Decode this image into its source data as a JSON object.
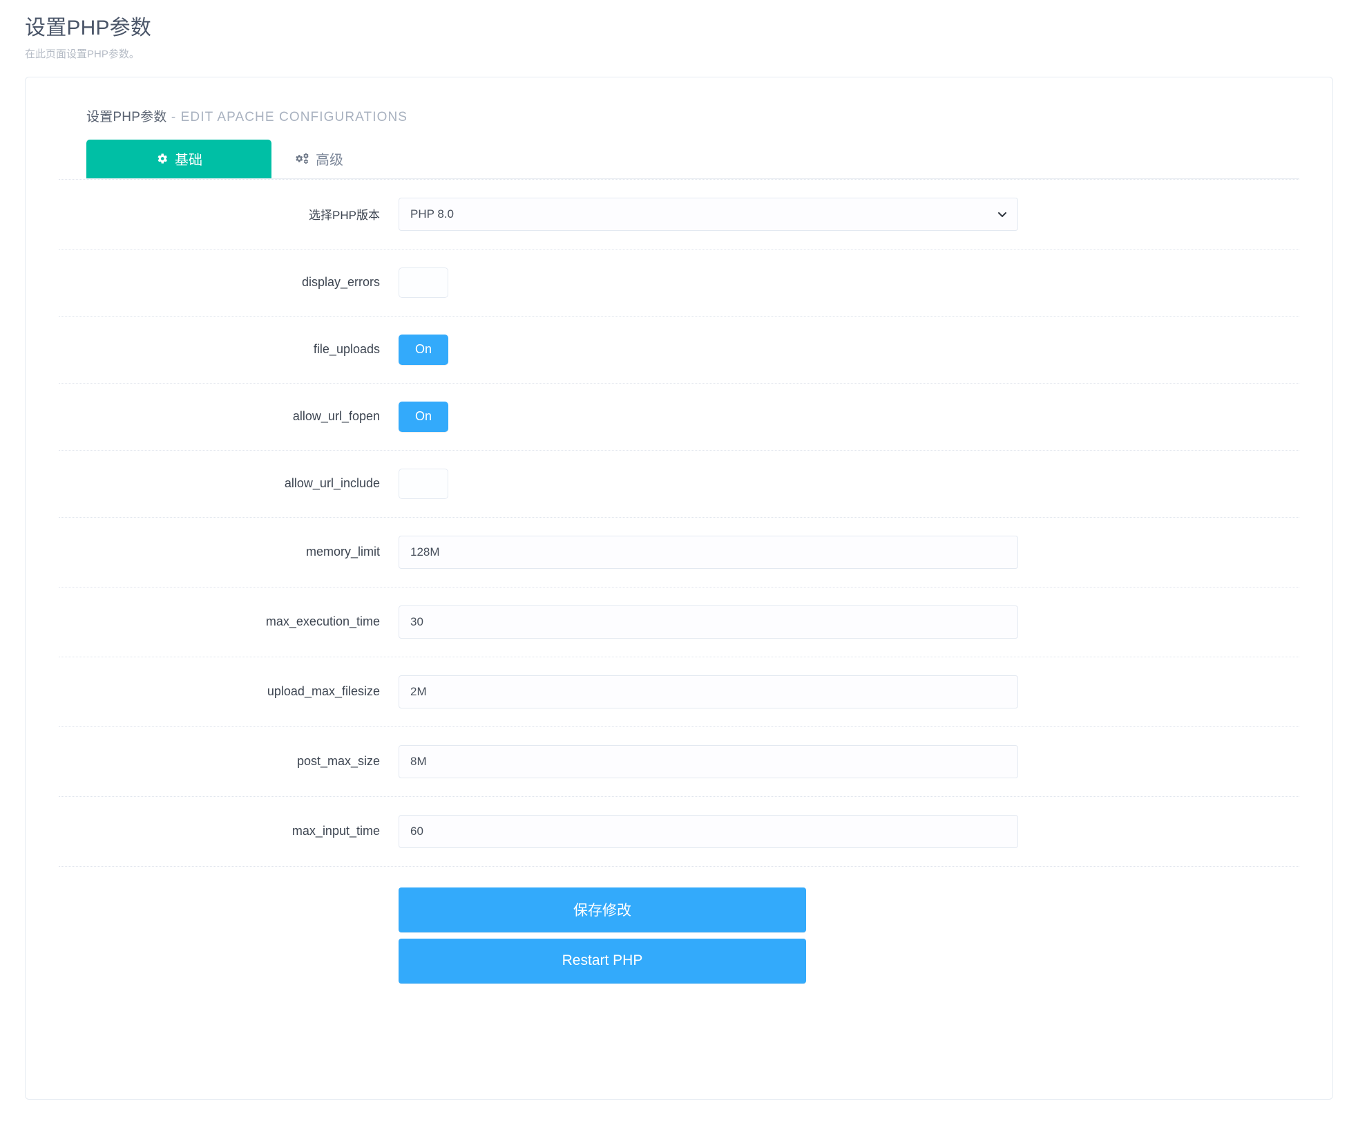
{
  "page": {
    "title": "设置PHP参数",
    "subtitle": "在此页面设置PHP参数。"
  },
  "card": {
    "title_cn": "设置PHP参数",
    "title_separator": " - ",
    "title_en": "EDIT APACHE CONFIGURATIONS"
  },
  "tabs": [
    {
      "label": "基础",
      "icon": "gear-icon",
      "active": true
    },
    {
      "label": "高级",
      "icon": "cogs-icon",
      "active": false
    }
  ],
  "form": {
    "php_version": {
      "label": "选择PHP版本",
      "value": "PHP 8.0",
      "options": [
        "PHP 8.0"
      ],
      "chevron": "chevron-down-icon"
    },
    "rows": [
      {
        "label": "display_errors",
        "type": "toggle",
        "value": "",
        "state": "off"
      },
      {
        "label": "file_uploads",
        "type": "toggle",
        "value": "On",
        "state": "on"
      },
      {
        "label": "allow_url_fopen",
        "type": "toggle",
        "value": "On",
        "state": "on"
      },
      {
        "label": "allow_url_include",
        "type": "toggle",
        "value": "",
        "state": "off"
      },
      {
        "label": "memory_limit",
        "type": "text",
        "value": "128M"
      },
      {
        "label": "max_execution_time",
        "type": "text",
        "value": "30"
      },
      {
        "label": "upload_max_filesize",
        "type": "text",
        "value": "2M"
      },
      {
        "label": "post_max_size",
        "type": "text",
        "value": "8M"
      },
      {
        "label": "max_input_time",
        "type": "text",
        "value": "60"
      }
    ]
  },
  "actions": {
    "save_label": "保存修改",
    "restart_label": "Restart PHP"
  },
  "colors": {
    "tab_active": "#00bfa5",
    "button_blue": "#33aafb",
    "title_gray": "#4a5568",
    "muted_gray": "#a9b2c0"
  }
}
